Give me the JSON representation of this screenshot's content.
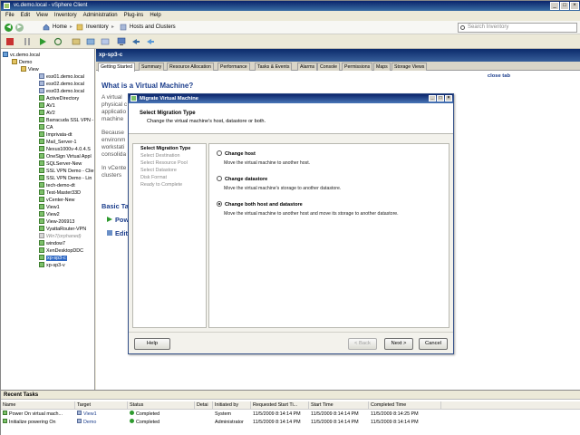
{
  "window": {
    "title": "vc.demo.local - vSphere Client"
  },
  "menu": [
    "File",
    "Edit",
    "View",
    "Inventory",
    "Administration",
    "Plug-ins",
    "Help"
  ],
  "nav": {
    "home": "Home",
    "inventory": "Inventory",
    "hosts_clusters": "Hosts and Clusters",
    "search_placeholder": "Search Inventory"
  },
  "tree": [
    {
      "label": "vc.demo.local",
      "icon": "vc",
      "indent": 0
    },
    {
      "label": "Demo",
      "icon": "dc",
      "indent": 1
    },
    {
      "label": "View",
      "icon": "dc",
      "indent": 2
    },
    {
      "label": "esx01.demo.local",
      "icon": "host",
      "indent": 4
    },
    {
      "label": "esx02.demo.local",
      "icon": "host",
      "indent": 4
    },
    {
      "label": "esx03.demo.local",
      "icon": "host",
      "indent": 4
    },
    {
      "label": "ActiveDirectory",
      "icon": "vm",
      "indent": 4
    },
    {
      "label": "AV1",
      "icon": "vm",
      "indent": 4
    },
    {
      "label": "AV2",
      "icon": "vm",
      "indent": 4
    },
    {
      "label": "Barracuda SSL VPN -",
      "icon": "vm",
      "indent": 4
    },
    {
      "label": "CA",
      "icon": "vm",
      "indent": 4
    },
    {
      "label": "Imprivata-dt",
      "icon": "vm",
      "indent": 4
    },
    {
      "label": "Mail_Server-1",
      "icon": "vm",
      "indent": 4
    },
    {
      "label": "Nexus1000v-4.0.4.S",
      "icon": "vm",
      "indent": 4
    },
    {
      "label": "OneSign Virtual Appl",
      "icon": "vm",
      "indent": 4
    },
    {
      "label": "SQLServer-New",
      "icon": "vm",
      "indent": 4
    },
    {
      "label": "SSL VPN Demo - Clie",
      "icon": "vm",
      "indent": 4
    },
    {
      "label": "SSL VPN Demo - Lin",
      "icon": "vm",
      "indent": 4
    },
    {
      "label": "tech-demo-dt",
      "icon": "vm",
      "indent": 4
    },
    {
      "label": "Test-Master33D",
      "icon": "vm",
      "indent": 4
    },
    {
      "label": "vCenter-New",
      "icon": "vm",
      "indent": 4
    },
    {
      "label": "View1",
      "icon": "vm",
      "indent": 4
    },
    {
      "label": "View2",
      "icon": "vm",
      "indent": 4
    },
    {
      "label": "View-206913",
      "icon": "vm",
      "indent": 4
    },
    {
      "label": "VyattaRouter-VPN",
      "icon": "vm",
      "indent": 4
    },
    {
      "label": "Win7(orphaned)",
      "icon": "vm-off",
      "indent": 4,
      "orphan": true
    },
    {
      "label": "window7",
      "icon": "vm",
      "indent": 4
    },
    {
      "label": "XenDesktopDDC",
      "icon": "vm",
      "indent": 4
    },
    {
      "label": "xp-sp3-c",
      "icon": "vm",
      "indent": 4,
      "selected": true
    },
    {
      "label": "xp-sp3-v",
      "icon": "vm",
      "indent": 4
    }
  ],
  "object": {
    "title": "xp-sp3-c"
  },
  "tabs": [
    "Getting Started",
    "Summary",
    "Resource Allocation",
    "Performance",
    "Tasks & Events",
    "Alarms",
    "Console",
    "Permissions",
    "Maps",
    "Storage Views"
  ],
  "getting_started": {
    "close_tab": "close tab",
    "heading": "What is a Virtual Machine?",
    "para1": [
      "A virtual",
      "physical c",
      "applicatio",
      "machine"
    ],
    "para2": [
      "Because",
      "environm",
      "workstati",
      "consolida"
    ],
    "para3": [
      "In vCente",
      "clusters"
    ],
    "basic_tasks": "Basic Ta",
    "task1": "Pow",
    "task2": "Edit"
  },
  "dialog": {
    "title": "Migrate Virtual Machine",
    "header_title": "Select Migration Type",
    "header_sub": "Change the virtual machine's host, datastore or both.",
    "steps": [
      "Select Migration Type",
      "Select Destination",
      "Select Resource Pool",
      "Select Datastore",
      "Disk Format",
      "Ready to Complete"
    ],
    "options": [
      {
        "label": "Change host",
        "desc": "Move the virtual machine to another host.",
        "selected": false
      },
      {
        "label": "Change datastore",
        "desc": "Move the virtual machine's storage to another datastore.",
        "selected": false
      },
      {
        "label": "Change both host and datastore",
        "desc": "Move the virtual machine to another host and move its storage to another datastore.",
        "selected": true
      }
    ],
    "help": "Help",
    "back": "< Back",
    "next": "Next >",
    "cancel": "Cancel"
  },
  "recent_tasks": {
    "title": "Recent Tasks",
    "columns": [
      "Name",
      "Target",
      "Status",
      "Detai",
      "Initiated by",
      "Requested Start Ti...",
      "Start Time",
      "Completed Time"
    ],
    "rows": [
      [
        "Power On virtual mach...",
        "View1",
        "Completed",
        "",
        "System",
        "11/5/2009 8:14:14 PM",
        "11/5/2009 8:14:14 PM",
        "11/5/2009 8:14:25 PM"
      ],
      [
        "Initialize powering On",
        "Demo",
        "Completed",
        "",
        "Administrator",
        "11/5/2009 8:14:14 PM",
        "11/5/2009 8:14:14 PM",
        "11/5/2009 8:14:14 PM"
      ]
    ]
  }
}
